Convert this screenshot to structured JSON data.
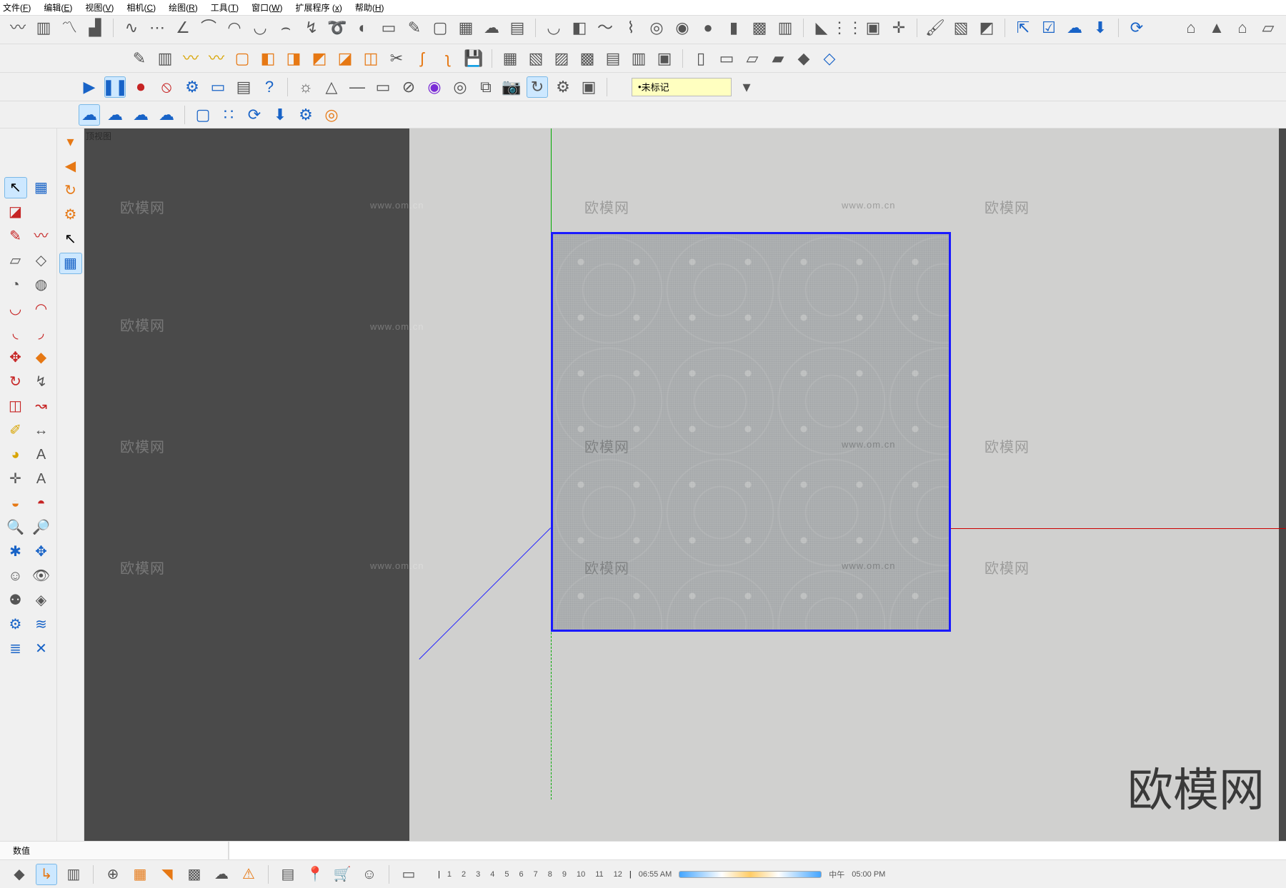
{
  "menu": {
    "file": {
      "label": "文件",
      "key": "F"
    },
    "edit": {
      "label": "编辑",
      "key": "E"
    },
    "view": {
      "label": "视图",
      "key": "V"
    },
    "camera": {
      "label": "相机",
      "key": "C"
    },
    "draw": {
      "label": "绘图",
      "key": "R"
    },
    "tools": {
      "label": "工具",
      "key": "T"
    },
    "window": {
      "label": "窗口",
      "key": "W"
    },
    "extensions": {
      "label": "扩展程序",
      "key": "x"
    },
    "help": {
      "label": "帮助",
      "key": "H"
    }
  },
  "tag_field": {
    "value": "未标记"
  },
  "viewport": {
    "label": "顶视图"
  },
  "watermarks": {
    "cn": "欧模网",
    "url": "www.om.cn"
  },
  "brand": "欧模网",
  "status": {
    "label": "数值",
    "value": ""
  },
  "timeline": {
    "hours": [
      "1",
      "2",
      "3",
      "4",
      "5",
      "6",
      "7",
      "8",
      "9",
      "10",
      "11",
      "12"
    ],
    "start": "06:55 AM",
    "mid": "中午",
    "end": "05:00 PM"
  }
}
